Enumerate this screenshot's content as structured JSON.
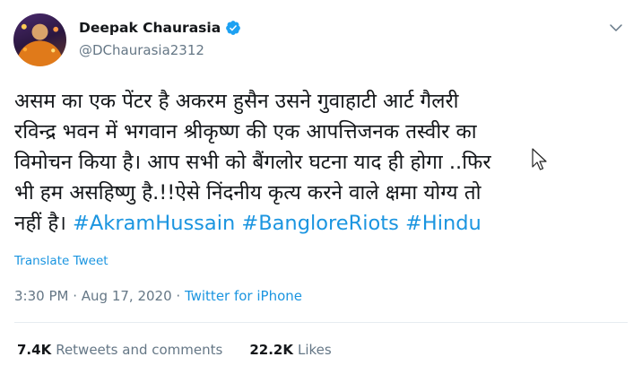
{
  "author": {
    "display_name": "Deepak Chaurasia",
    "handle": "@DChaurasia2312",
    "verified": true
  },
  "tweet": {
    "text_line_1": "असम का एक पेंटर है अकरम हुसैन उसने गुवाहाटी आर्ट गैलरी",
    "text_line_2": "रविन्द्र भवन में भगवान श्रीकृष्ण की एक आपत्तिजनक तस्वीर का",
    "text_line_3": "विमोचन किया है। आप सभी को बैंगलोर घटना याद ही होगा ..फिर",
    "text_line_4": "भी हम असहिष्णु है.!!ऐसे निंदनीय कृत्य करने वाले क्षमा योग्य तो",
    "text_line_5_prefix": "नहीं है। ",
    "hashtags": [
      "#AkramHussain",
      "#BangloreRiots",
      "#Hindu"
    ],
    "translate_label": "Translate Tweet",
    "time": "3:30 PM",
    "date": "Aug 17, 2020",
    "separator": " · ",
    "source": "Twitter for iPhone"
  },
  "stats": {
    "retweets_count": "7.4K",
    "retweets_label": "Retweets and comments",
    "likes_count": "22.2K",
    "likes_label": "Likes"
  },
  "colors": {
    "link": "#1b95e0",
    "secondary_text": "#657786",
    "primary_text": "#14171a"
  },
  "icons": [
    "verified-badge-icon",
    "chevron-down-icon",
    "mouse-pointer-icon"
  ]
}
